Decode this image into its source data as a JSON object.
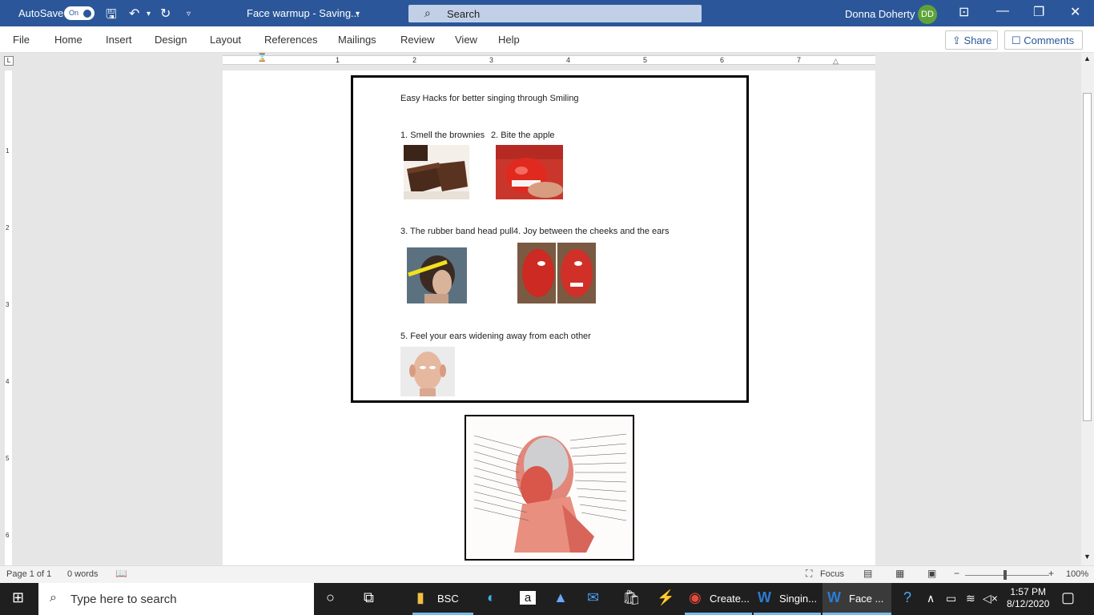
{
  "titlebar": {
    "autosave_label": "AutoSave",
    "autosave_state": "On",
    "doc_title": "Face warmup  -  Saving...",
    "search_placeholder": "Search",
    "user_name": "Donna Doherty",
    "user_initials": "DD"
  },
  "menu": {
    "items": [
      "File",
      "Home",
      "Insert",
      "Design",
      "Layout",
      "References",
      "Mailings",
      "Review",
      "View",
      "Help"
    ],
    "share": "Share",
    "comments": "Comments"
  },
  "ruler": {
    "numbers": [
      "1",
      "2",
      "3",
      "4",
      "5",
      "6",
      "7"
    ]
  },
  "vruler": {
    "numbers": [
      "1",
      "2",
      "3",
      "4",
      "5",
      "6"
    ]
  },
  "document": {
    "heading": "Easy Hacks for better singing through Smiling",
    "item1": "1.  Smell the brownies",
    "item2": "2.  Bite the apple",
    "item3": "3.  The rubber band head pull",
    "item4": "4.  Joy between the cheeks and the ears",
    "item5": "5.  Feel your ears widening away from each other"
  },
  "status": {
    "page": "Page 1 of 1",
    "words": "0 words",
    "focus": "Focus",
    "zoom": "100%"
  },
  "taskbar": {
    "search_placeholder": "Type here to search",
    "bsc": "BSC",
    "chrome": "Create...",
    "word1": "Singin...",
    "word2": "Face ...",
    "time": "1:57 PM",
    "date": "8/12/2020"
  },
  "colors": {
    "word_blue": "#2b579a",
    "taskbar": "#1f1f1f"
  }
}
